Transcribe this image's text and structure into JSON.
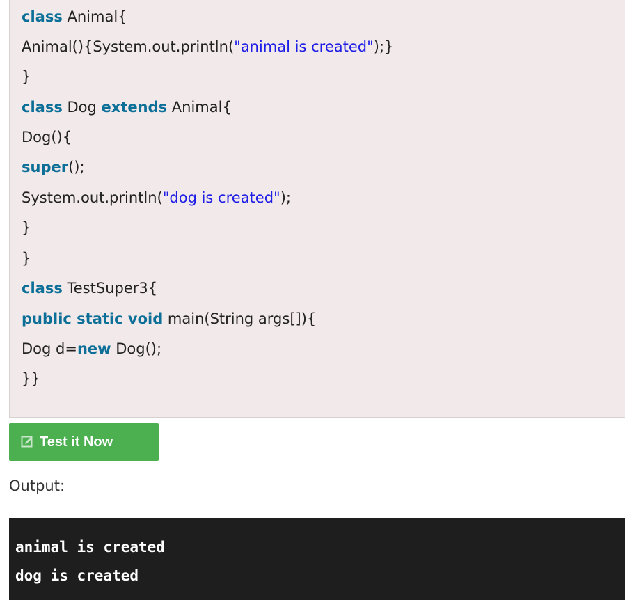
{
  "code": {
    "lines": [
      {
        "kw1": "class",
        "text1": " Animal{"
      },
      {
        "text1": "Animal(){System.out.println(",
        "str": "\"animal is created\"",
        "text2": ");}"
      },
      {
        "text1": "}"
      },
      {
        "kw1": "class",
        "text1": " Dog ",
        "kw2": "extends",
        "text2": " Animal{"
      },
      {
        "text1": "Dog(){"
      },
      {
        "kw1": "super",
        "text1": "();"
      },
      {
        "text1": "System.out.println(",
        "str": "\"dog is created\"",
        "text2": ");"
      },
      {
        "text1": "}"
      },
      {
        "text1": "}"
      },
      {
        "kw1": "class",
        "text1": " TestSuper3{"
      },
      {
        "kw1": "public static void",
        "text1": " main(String args[]){"
      },
      {
        "text1": "Dog d=",
        "kw2": "new",
        "text2": " Dog();"
      },
      {
        "text1": "}}"
      }
    ]
  },
  "test_button": {
    "label": "Test it Now",
    "icon": "edit-icon",
    "color": "#4caf50"
  },
  "output": {
    "label": "Output:",
    "lines": [
      "animal is created",
      "dog is created"
    ]
  }
}
